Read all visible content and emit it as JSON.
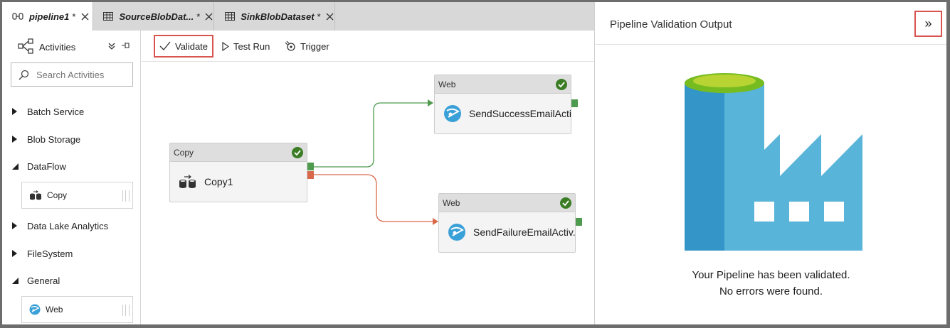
{
  "tabs": [
    {
      "label": "pipeline1",
      "modified": "*",
      "icon": "pipeline-icon",
      "active": true
    },
    {
      "label": "SourceBlobDat...",
      "modified": "*",
      "icon": "table-icon",
      "active": false
    },
    {
      "label": "SinkBlobDataset",
      "modified": "*",
      "icon": "table-icon",
      "active": false
    }
  ],
  "activities": {
    "title": "Activities",
    "search_placeholder": "Search Activities",
    "categories": [
      {
        "label": "Batch Service",
        "expanded": false
      },
      {
        "label": "Blob Storage",
        "expanded": false
      },
      {
        "label": "DataFlow",
        "expanded": true
      },
      {
        "label": "Data Lake Analytics",
        "expanded": false
      },
      {
        "label": "FileSystem",
        "expanded": false
      },
      {
        "label": "General",
        "expanded": true
      }
    ],
    "items": [
      {
        "label": "Copy",
        "icon": "copy-icon"
      },
      {
        "label": "Web",
        "icon": "web-icon"
      }
    ]
  },
  "toolbar": {
    "validate": "Validate",
    "test_run": "Test Run",
    "trigger": "Trigger"
  },
  "canvas": {
    "nodes": [
      {
        "type": "Copy",
        "name": "Copy1",
        "icon": "copy-icon"
      },
      {
        "type": "Web",
        "name": "SendSuccessEmailActi...",
        "icon": "web-icon"
      },
      {
        "type": "Web",
        "name": "SendFailureEmailActiv...",
        "icon": "web-icon"
      }
    ],
    "colors": {
      "success": "#4e9a4e",
      "failure": "#d9684a",
      "check": "#3a7d24"
    }
  },
  "validation": {
    "title": "Pipeline Validation Output",
    "line1": "Your Pipeline has been validated.",
    "line2": "No errors were found.",
    "close_glyph": "»"
  }
}
